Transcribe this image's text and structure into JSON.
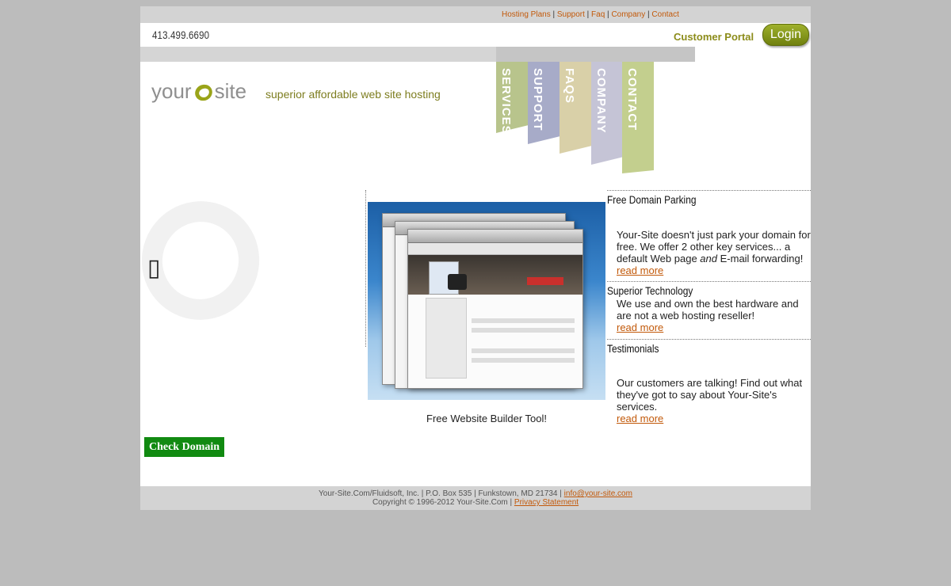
{
  "topnav": {
    "links": [
      "Hosting Plans",
      "Support",
      "Faq",
      "Company",
      "Contact"
    ],
    "separator": " | "
  },
  "header": {
    "phone": "413.499.6690",
    "portal_label": "Customer Portal",
    "login_label": "Login"
  },
  "logo": {
    "part1": "your",
    "part2": "site",
    "tagline": "superior  affordable web site hosting"
  },
  "tabs": [
    {
      "label": "SERVICES",
      "color": "#b8c48c"
    },
    {
      "label": "SUPPORT",
      "color": "#a7abc8"
    },
    {
      "label": "FAQS",
      "color": "#d9d0a8"
    },
    {
      "label": "COMPANY",
      "color": "#c5c4d6"
    },
    {
      "label": "CONTACT",
      "color": "#c3cf8e"
    }
  ],
  "left": {
    "glyph": "▯",
    "check_domain_label": "Check Domain"
  },
  "center": {
    "caption": "Free Website Builder Tool!"
  },
  "sections": {
    "parking": {
      "title": "Free Domain Parking",
      "body_pre": "Your-Site doesn't just park your domain for free. We offer 2 other key services... a default Web page ",
      "body_em": "and",
      "body_post": " E-mail forwarding!",
      "more": "read more"
    },
    "tech": {
      "title": "Superior Technology",
      "body": "We use and own the best hardware and are not a web hosting reseller!",
      "more": "read more"
    },
    "testimonials": {
      "title": "Testimonials",
      "body": "Our customers are talking! Find out what they've got to say about Your-Site's services.",
      "more": "read more"
    }
  },
  "footer": {
    "line1": "Your-Site.Com/Fluidsoft, Inc. | P.O. Box 535 | Funkstown, MD 21734 | ",
    "email": "info@your-site.com",
    "line2": "Copyright © 1996-2012 Your-Site.Com | ",
    "privacy": "Privacy Statement"
  }
}
